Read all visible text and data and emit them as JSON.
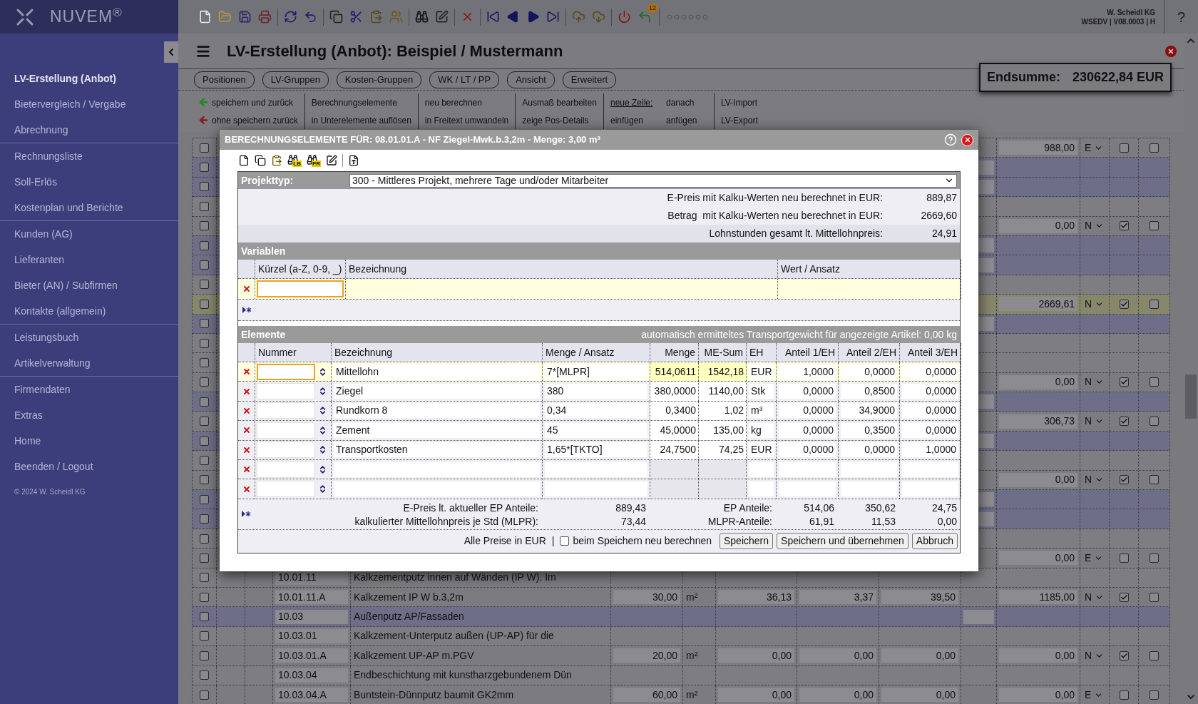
{
  "sidebar": {
    "logo": "NUVEM$^{®}$",
    "groups": [
      [
        {
          "label": "LV-Erstellung (Anbot)",
          "selected": true
        },
        {
          "label": "Bietervergleich / Vergabe",
          "selected": false
        },
        {
          "label": "Abrechnung",
          "selected": false
        }
      ],
      [
        {
          "label": "Rechnungsliste",
          "selected": false
        },
        {
          "label": "Soll-Erlös",
          "selected": false
        },
        {
          "label": "Kostenplan und Berichte",
          "selected": false
        }
      ],
      [
        {
          "label": "Kunden (AG)",
          "selected": false
        },
        {
          "label": "Lieferanten",
          "selected": false
        },
        {
          "label": "Bieter (AN) / Subfirmen",
          "selected": false
        },
        {
          "label": "Kontakte (allgemein)",
          "selected": false
        }
      ],
      [
        {
          "label": "Leistungsbuch",
          "selected": false
        },
        {
          "label": "Artikelverwaltung",
          "selected": false
        }
      ],
      [
        {
          "label": "Firmendaten",
          "selected": false
        },
        {
          "label": "Extras",
          "selected": false
        },
        {
          "label": "Home",
          "selected": false
        },
        {
          "label": "Beenden / Logout",
          "selected": false
        }
      ]
    ],
    "footer": "© 2024 W. Scheidl KG"
  },
  "toolbar": {
    "badge": "12"
  },
  "account": {
    "company": "W. Scheidl KG",
    "info": "WSEDV | V08.0003 | H",
    "help": "?"
  },
  "page": {
    "title": "LV-Erstellung (Anbot): Beispiel / Mustermann",
    "tabs": [
      {
        "label": "Positionen",
        "selected": false
      },
      {
        "label": "LV-Gruppen",
        "selected": false
      },
      {
        "label": "Kosten-Gruppen",
        "selected": false
      },
      {
        "label": "WK / LT / PP",
        "selected": false
      },
      {
        "label": "Ansicht",
        "selected": false
      },
      {
        "label": "Erweitert",
        "selected": false
      }
    ],
    "actions": [
      {
        "lines": [
          [
            {
              "kind": "back",
              "label": "speichern und zurück",
              "color": "#1f8a1f"
            }
          ],
          [
            {
              "kind": "back",
              "label": "ohne speichern zurück",
              "color": "#8b1a1a"
            }
          ]
        ]
      },
      {
        "lines": [
          [
            {
              "kind": "link",
              "label": "Berechnungselemente"
            }
          ],
          [
            {
              "kind": "link",
              "label": "in Unterelemente auflösen"
            }
          ]
        ]
      },
      {
        "lines": [
          [
            {
              "kind": "link",
              "label": "neu berechnen"
            }
          ],
          [
            {
              "kind": "link",
              "label": "in Freitext umwandeln"
            }
          ]
        ]
      },
      {
        "lines": [
          [
            {
              "kind": "link",
              "label": "Ausmaß bearbeiten"
            }
          ],
          [
            {
              "kind": "link",
              "label": "zeige Pos-Details"
            }
          ]
        ]
      },
      {
        "lines": [
          [
            {
              "kind": "heading",
              "label": "neue Zeile:"
            },
            {
              "kind": "link",
              "label": "danach"
            }
          ],
          [
            {
              "kind": "link",
              "label": "einfügen"
            },
            {
              "kind": "link",
              "label": "anfügen"
            }
          ]
        ]
      },
      {
        "lines": [
          [
            {
              "kind": "link",
              "label": "LV-Import"
            }
          ],
          [
            {
              "kind": "link",
              "label": "LV-Export"
            }
          ]
        ]
      }
    ],
    "total": {
      "label": "Endsumme:",
      "value": "230622,84 EUR"
    }
  },
  "table": {
    "rows": [
      {
        "kind": "position",
        "selected": false,
        "checked": false,
        "amount": "988,00",
        "type": "E",
        "flag_a": false,
        "flag_b": false
      },
      {
        "kind": "group",
        "selected": false,
        "checked": false
      },
      {
        "kind": "group",
        "selected": false,
        "checked": false
      },
      {
        "kind": "text",
        "selected": false,
        "checked": false
      },
      {
        "kind": "position",
        "selected": false,
        "checked": false,
        "amount": "0,00",
        "type": "N",
        "flag_a": true,
        "flag_b": false
      },
      {
        "kind": "group",
        "selected": false,
        "checked": false
      },
      {
        "kind": "group",
        "selected": false,
        "checked": false
      },
      {
        "kind": "text",
        "selected": false,
        "checked": false
      },
      {
        "kind": "position",
        "selected": true,
        "checked": false,
        "amount": "2669,61",
        "type": "N",
        "flag_a": true,
        "flag_b": false
      },
      {
        "kind": "group",
        "selected": false,
        "checked": false
      },
      {
        "kind": "text",
        "selected": false,
        "checked": false
      },
      {
        "kind": "text",
        "selected": false,
        "checked": false
      },
      {
        "kind": "position",
        "selected": false,
        "checked": false,
        "amount": "0,00",
        "type": "N",
        "flag_a": true,
        "flag_b": false
      },
      {
        "kind": "group",
        "selected": false,
        "checked": false
      },
      {
        "kind": "position",
        "selected": false,
        "checked": false,
        "amount": "306,73",
        "type": "N",
        "flag_a": true,
        "flag_b": false
      },
      {
        "kind": "group",
        "selected": false,
        "checked": false
      },
      {
        "kind": "text",
        "selected": false,
        "checked": false
      },
      {
        "kind": "position",
        "selected": false,
        "checked": false,
        "amount": "0,00",
        "type": "N",
        "flag_a": true,
        "flag_b": false
      },
      {
        "kind": "group",
        "selected": false,
        "checked": false
      },
      {
        "kind": "group",
        "selected": false,
        "checked": false
      },
      {
        "kind": "text",
        "selected": false,
        "checked": false
      },
      {
        "kind": "position",
        "selected": false,
        "checked": false,
        "amount": "0,00",
        "type": "E",
        "flag_a": false,
        "flag_b": false
      },
      {
        "kind": "text",
        "selected": false,
        "checked": false,
        "number": "10.01.11",
        "text": "Kalkzementputz innen auf Wänden (IP W). Im"
      },
      {
        "kind": "position",
        "selected": false,
        "checked": false,
        "number": "10.01.11.A",
        "text": "Kalkzement IP W b.3,2m",
        "quantity": "30,00",
        "unit": "m²",
        "values": [
          "36,13",
          "3,37",
          "39,50"
        ],
        "amount": "1185,00",
        "type": "N",
        "flag_a": true,
        "flag_b": false
      },
      {
        "kind": "group",
        "selected": false,
        "checked": false,
        "number": "10.03",
        "text": "Außenputz AP/Fassaden"
      },
      {
        "kind": "text",
        "selected": false,
        "checked": false,
        "number": "10.03.01",
        "text": "Kalkzement-Unterputz außen (UP-AP) für die"
      },
      {
        "kind": "position",
        "selected": false,
        "checked": false,
        "number": "10.03.01.A",
        "text": "Kalkzement UP-AP m.PGV",
        "quantity": "20,00",
        "unit": "m²",
        "values": [
          "0,00",
          "0,00",
          "0,00"
        ],
        "amount": "0,00",
        "type": "N",
        "flag_a": true,
        "flag_b": false
      },
      {
        "kind": "text",
        "selected": false,
        "checked": false,
        "number": "10.03.04",
        "text": "Endbeschichtung mit kunstharzgebundenem Dün"
      },
      {
        "kind": "position",
        "selected": false,
        "checked": false,
        "number": "10.03.04.A",
        "text": "Buntstein-Dünnputz baumit GK2mm",
        "quantity": "60,00",
        "unit": "m²",
        "values": [
          "0,00",
          "0,00",
          "0,00"
        ],
        "amount": "0,00",
        "type": "E",
        "flag_a": false,
        "flag_b": false
      }
    ]
  },
  "dialog": {
    "title": "BERECHNUNGSELEMENTE FÜR: 08.01.01.A - NF Ziegel-Mwk.b.3,2m - Menge: 3,00 m³",
    "icon_labels": [
      "LB",
      "PR"
    ],
    "project_type": {
      "label": "Projekttyp:",
      "value": "300 - Mittleres Projekt, mehrere Tage und/oder Mitarbeiter"
    },
    "info": [
      {
        "label": "E-Preis mit Kalku-Werten neu berechnet in EUR:",
        "value": "889,87"
      },
      {
        "label": "Betrag  mit Kalku-Werten neu berechnet in EUR:",
        "value": "2669,60"
      },
      {
        "label": "Lohnstunden gesamt lt. Mittellohnpreis:",
        "value": "24,91"
      }
    ],
    "variables": {
      "title": "Variablen",
      "columns": [
        "Kürzel (a-Z, 0-9, _)",
        "Bezeichnung",
        "Wert / Ansatz"
      ],
      "rows": [
        {
          "selected": true
        }
      ]
    },
    "elements": {
      "title": "Elemente",
      "note": "automatisch ermitteltes Transportgewicht für angezeigte Artikel: 0,00 kg",
      "columns": [
        "Nummer",
        "Bezeichnung",
        "Menge / Ansatz",
        "Menge",
        "ME-Sum",
        "EH",
        "Anteil 1/EH",
        "Anteil 2/EH",
        "Anteil 3/EH"
      ],
      "rows": [
        {
          "selected": true,
          "name": "Mittellohn",
          "formula": "7*[MLPR]",
          "quantity": "514,0611",
          "sum": "1542,18",
          "unit": "EUR",
          "shares": [
            "1,0000",
            "0,0000",
            "0,0000"
          ]
        },
        {
          "selected": false,
          "name": "Ziegel",
          "formula": "380",
          "quantity": "380,0000",
          "sum": "1140,00",
          "unit": "Stk",
          "shares": [
            "0,0000",
            "0,8500",
            "0,0000"
          ]
        },
        {
          "selected": false,
          "name": "Rundkorn 8",
          "formula": "0,34",
          "quantity": "0,3400",
          "sum": "1,02",
          "unit": "m³",
          "shares": [
            "0,0000",
            "34,9000",
            "0,0000"
          ]
        },
        {
          "selected": false,
          "name": "Zement",
          "formula": "45",
          "quantity": "45,0000",
          "sum": "135,00",
          "unit": "kg",
          "shares": [
            "0,0000",
            "0,3500",
            "0,0000"
          ]
        },
        {
          "selected": false,
          "name": "Transportkosten",
          "formula": "1,65*[TKTO]",
          "quantity": "24,7500",
          "sum": "74,25",
          "unit": "EUR",
          "shares": [
            "0,0000",
            "0,0000",
            "1,0000"
          ]
        },
        {
          "selected": false
        },
        {
          "selected": false
        }
      ],
      "summary": [
        {
          "label": "E-Preis lt. aktueller EP Anteile:",
          "value": "889,43",
          "label_2": "EP Anteile:",
          "shares": [
            "514,06",
            "350,62",
            "24,75"
          ]
        },
        {
          "label": "kalkulierter Mittellohnpreis je Std (MLPR):",
          "value": "73,44",
          "label_2": "MLPR-Anteile:",
          "shares": [
            "61,91",
            "11,53",
            "0,00"
          ]
        }
      ]
    },
    "footer": {
      "note": "Alle Preise in EUR",
      "separator": "|",
      "checkbox": {
        "label": "beim Speichern neu berechnen",
        "checked": false
      },
      "buttons": [
        "Speichern",
        "Speichern und übernehmen",
        "Abbruch"
      ]
    }
  }
}
